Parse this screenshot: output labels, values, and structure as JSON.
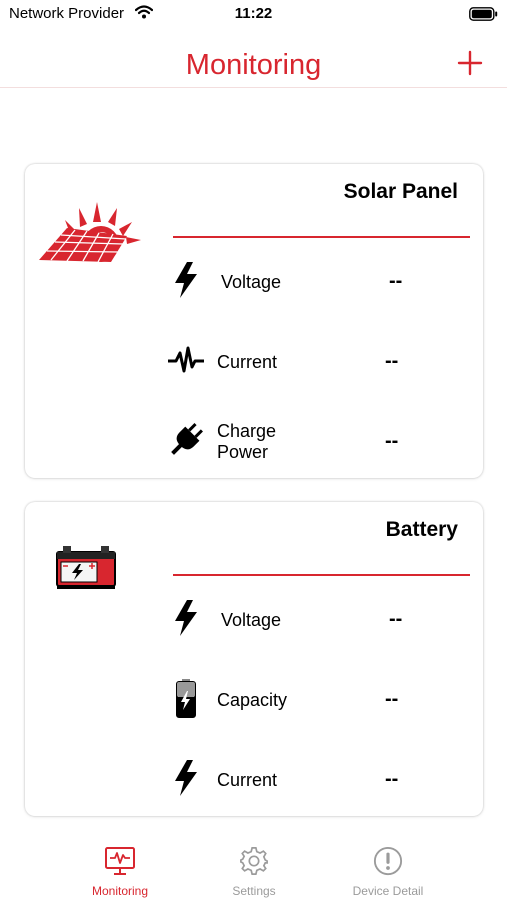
{
  "status_bar": {
    "carrier": "Network Provider",
    "time": "11:22"
  },
  "nav": {
    "title": "Monitoring",
    "add_icon": "plus-icon"
  },
  "colors": {
    "accent": "#d8262f",
    "inactive": "#9b9b9b"
  },
  "solar_panel": {
    "title": "Solar Panel",
    "image": "solar-panel-sun-image",
    "rows": [
      {
        "icon": "lightning-bolt-icon",
        "label": "Voltage",
        "value": "--"
      },
      {
        "icon": "pulse-waveform-icon",
        "label": "Current",
        "value": "--"
      },
      {
        "icon": "plug-icon",
        "label_line1": "Charge",
        "label_line2": "Power",
        "value": "--"
      }
    ]
  },
  "battery": {
    "title": "Battery",
    "image": "car-battery-image",
    "rows": [
      {
        "icon": "lightning-bolt-icon",
        "label": "Voltage",
        "value": "--"
      },
      {
        "icon": "battery-charging-icon",
        "label": "Capacity",
        "value": "--"
      },
      {
        "icon": "lightning-bolt-icon",
        "label": "Current",
        "value": "--"
      }
    ]
  },
  "tabs": [
    {
      "label": "Monitoring",
      "icon": "monitor-pulse-icon",
      "active": true
    },
    {
      "label": "Settings",
      "icon": "gear-icon",
      "active": false
    },
    {
      "label": "Device Detail",
      "icon": "info-exclamation-icon",
      "active": false
    }
  ]
}
